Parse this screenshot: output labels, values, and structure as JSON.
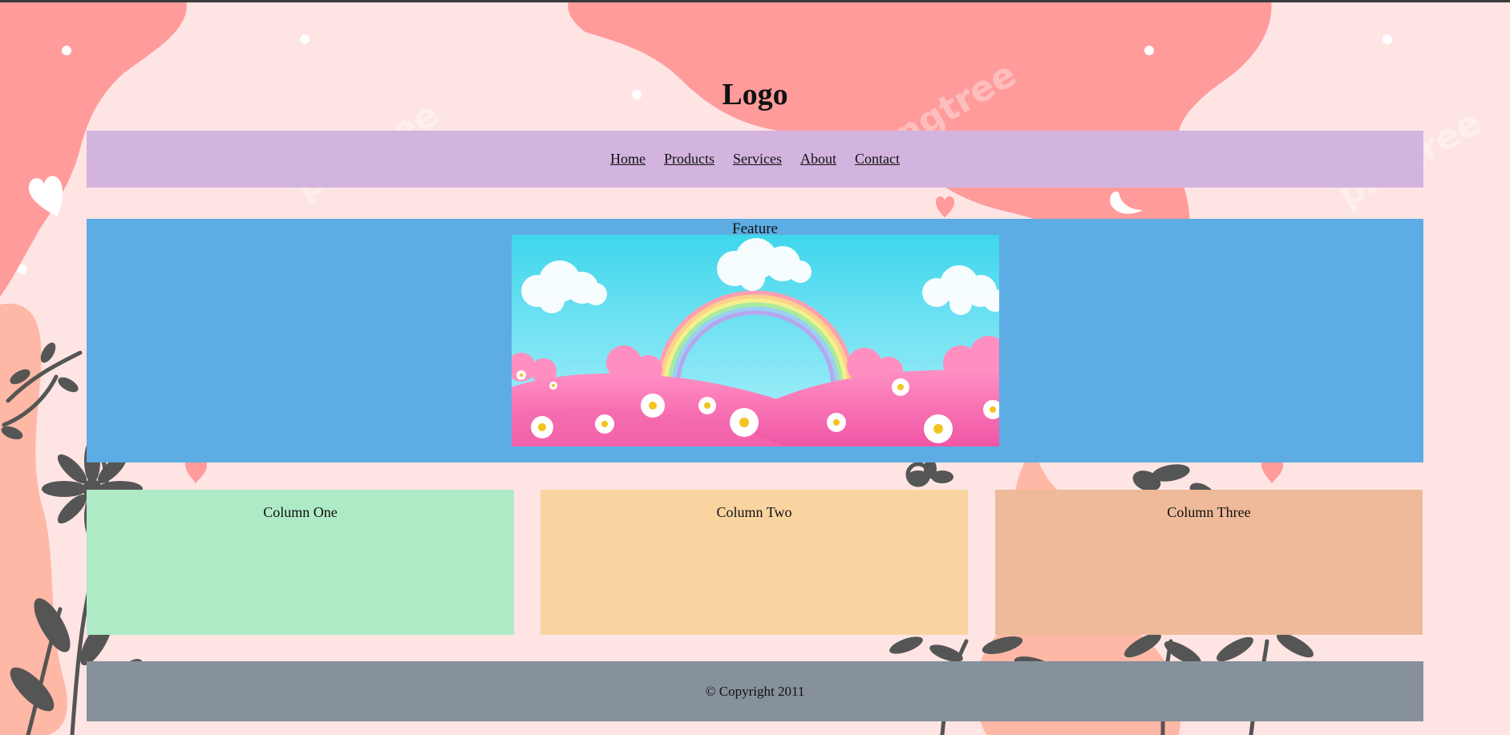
{
  "header": {
    "logo_text": "Logo"
  },
  "nav": {
    "items": [
      {
        "label": "Home"
      },
      {
        "label": "Products"
      },
      {
        "label": "Services"
      },
      {
        "label": "About"
      },
      {
        "label": "Contact"
      }
    ]
  },
  "feature": {
    "title": "Feature",
    "image": "rainbow-landscape-illustration"
  },
  "columns": [
    {
      "label": "Column One",
      "color": "#aeeac6"
    },
    {
      "label": "Column Two",
      "color": "#f9d4a1"
    },
    {
      "label": "Column Three",
      "color": "#eeba99"
    }
  ],
  "footer": {
    "text": "© Copyright 2011"
  },
  "colors": {
    "page_background": "#fee5e4",
    "blob": "#ff9b9b",
    "nav_background": "#d3b4df",
    "feature_background": "#5dace3",
    "footer_background": "#86919b"
  }
}
